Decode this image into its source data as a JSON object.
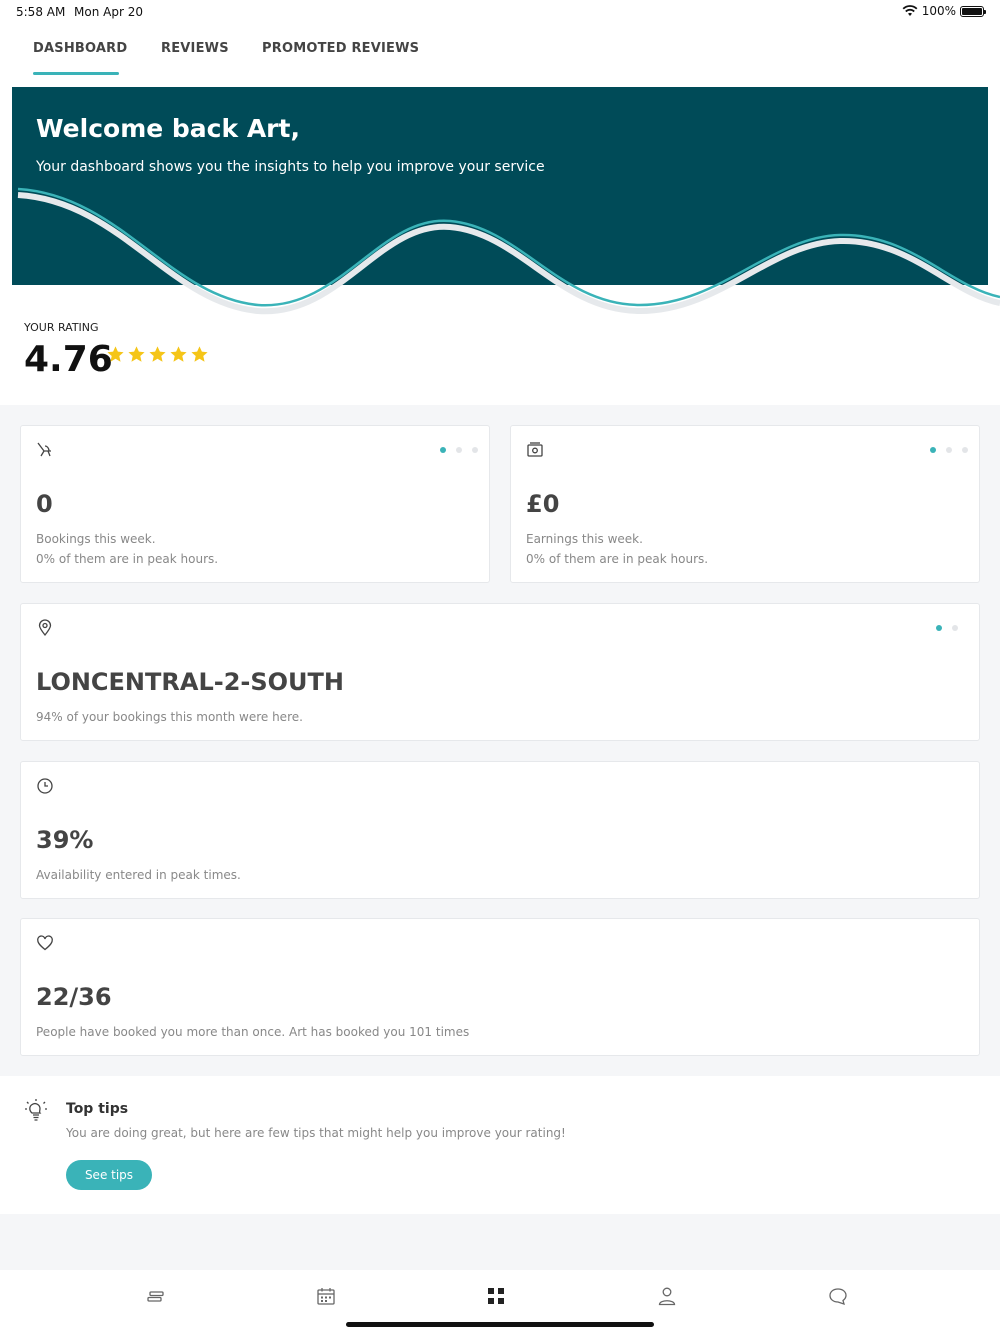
{
  "status_bar": {
    "time": "5:58 AM",
    "date": "Mon Apr 20",
    "battery": "100%"
  },
  "tabs": [
    {
      "label": "DASHBOARD"
    },
    {
      "label": "REVIEWS"
    },
    {
      "label": "PROMOTED REVIEWS"
    }
  ],
  "hero": {
    "title": "Welcome back Art,",
    "subtitle": "Your dashboard shows you the insights to help you improve your service"
  },
  "rating": {
    "label": "YOUR RATING",
    "value": "4.76",
    "stars": 5
  },
  "cards": {
    "bookings": {
      "icon": "stroller-icon",
      "value": "0",
      "line1": "Bookings this week.",
      "line2": "0% of them are in peak hours."
    },
    "earnings": {
      "icon": "camera-icon",
      "value": "£0",
      "line1": "Earnings this week.",
      "line2": "0% of them are in peak hours."
    },
    "location": {
      "icon": "location-pin-icon",
      "value": "LONCENTRAL-2-SOUTH",
      "line1": "94% of your bookings this month were here."
    },
    "availability": {
      "icon": "clock-icon",
      "value": "39%",
      "line1": "Availability entered in peak times."
    },
    "repeat": {
      "icon": "heart-icon",
      "value": "22/36",
      "line1": "People have booked you more than once. Art has booked you 101 times"
    }
  },
  "tips": {
    "icon": "lightbulb-icon",
    "title": "Top tips",
    "text": "You are doing great, but here are few tips that might help you improve your rating!",
    "button": "See tips"
  },
  "colors": {
    "primary": "#004b58",
    "accent": "#3ab3b8",
    "star": "#f5c518"
  }
}
